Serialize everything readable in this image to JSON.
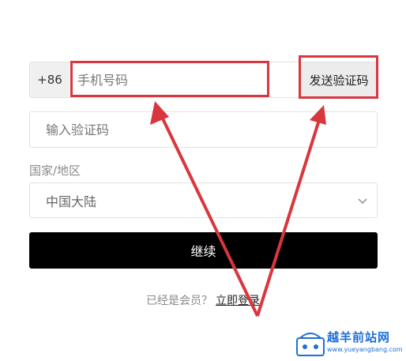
{
  "phone": {
    "country_code": "+86",
    "placeholder": "手机号码",
    "send_code_label": "发送验证码"
  },
  "verification": {
    "placeholder": "输入验证码"
  },
  "region": {
    "label": "国家/地区",
    "selected": "中国大陆"
  },
  "continue_label": "继续",
  "footer": {
    "member_prompt": "已经是会员？",
    "login_link": "立即登录"
  },
  "watermark": {
    "brand": "越羊前站网",
    "url": "www.yueyangbang.com"
  },
  "colors": {
    "highlight": "#d9363e",
    "button_bg": "#000000",
    "watermark": "#1e6fd9"
  }
}
